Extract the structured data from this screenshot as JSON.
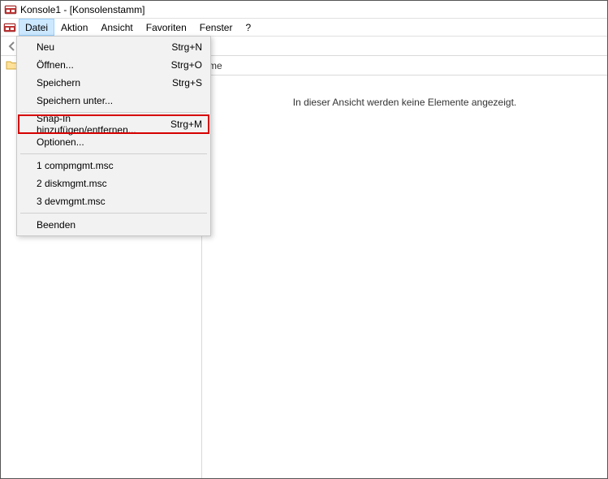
{
  "window": {
    "title": "Konsole1 - [Konsolenstamm]"
  },
  "menubar": {
    "items": [
      {
        "label": "Datei",
        "active": true
      },
      {
        "label": "Aktion",
        "active": false
      },
      {
        "label": "Ansicht",
        "active": false
      },
      {
        "label": "Favoriten",
        "active": false
      },
      {
        "label": "Fenster",
        "active": false
      },
      {
        "label": "?",
        "active": false
      }
    ]
  },
  "dropdown": {
    "items": [
      {
        "label": "Neu",
        "shortcut": "Strg+N"
      },
      {
        "label": "Öffnen...",
        "shortcut": "Strg+O"
      },
      {
        "label": "Speichern",
        "shortcut": "Strg+S"
      },
      {
        "label": "Speichern unter...",
        "shortcut": ""
      }
    ],
    "items2": [
      {
        "label": "Snap-In hinzufügen/entfernen...",
        "shortcut": "Strg+M",
        "highlighted": true
      },
      {
        "label": "Optionen...",
        "shortcut": ""
      }
    ],
    "recent": [
      {
        "label": "1 compmgmt.msc"
      },
      {
        "label": "2 diskmgmt.msc"
      },
      {
        "label": "3 devmgmt.msc"
      }
    ],
    "exit": {
      "label": "Beenden"
    }
  },
  "content": {
    "column_header": "me",
    "empty_message": "In dieser Ansicht werden keine Elemente angezeigt."
  }
}
